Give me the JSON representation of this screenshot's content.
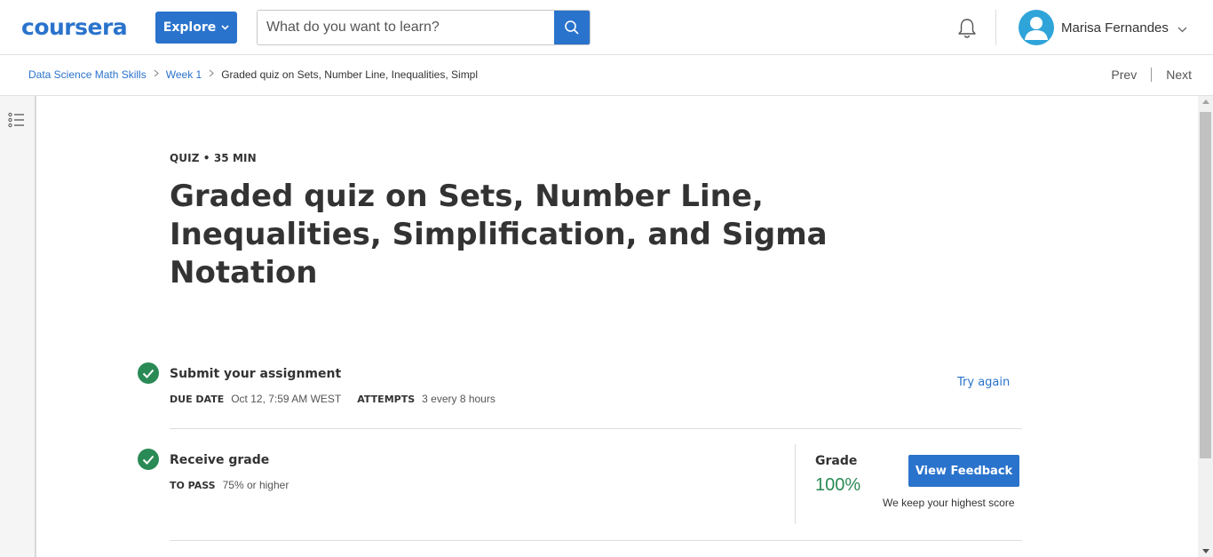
{
  "header": {
    "logo_text": "coursera",
    "explore_label": "Explore",
    "search_placeholder": "What do you want to learn?",
    "user_name": "Marisa Fernandes"
  },
  "breadcrumb": {
    "items": [
      "Data Science Math Skills",
      "Week 1"
    ],
    "current": "Graded quiz on Sets, Number Line, Inequalities, Simpl",
    "prev_label": "Prev",
    "next_label": "Next"
  },
  "quiz": {
    "kicker": "QUIZ • 35 MIN",
    "title": "Graded quiz on Sets, Number Line, Inequalities, Simplification, and Sigma Notation"
  },
  "submit_step": {
    "title": "Submit your assignment",
    "due_label": "DUE DATE",
    "due_value": "Oct 12, 7:59 AM WEST",
    "attempts_label": "ATTEMPTS",
    "attempts_value": "3 every 8 hours",
    "try_again_label": "Try again"
  },
  "grade_step": {
    "title": "Receive grade",
    "pass_label": "TO PASS",
    "pass_value": "75% or higher",
    "grade_label": "Grade",
    "grade_value": "100%",
    "feedback_button": "View Feedback",
    "keep_note": "We keep your highest score"
  },
  "colors": {
    "brand_blue": "#2a73cc",
    "success_green": "#2a8a55"
  }
}
